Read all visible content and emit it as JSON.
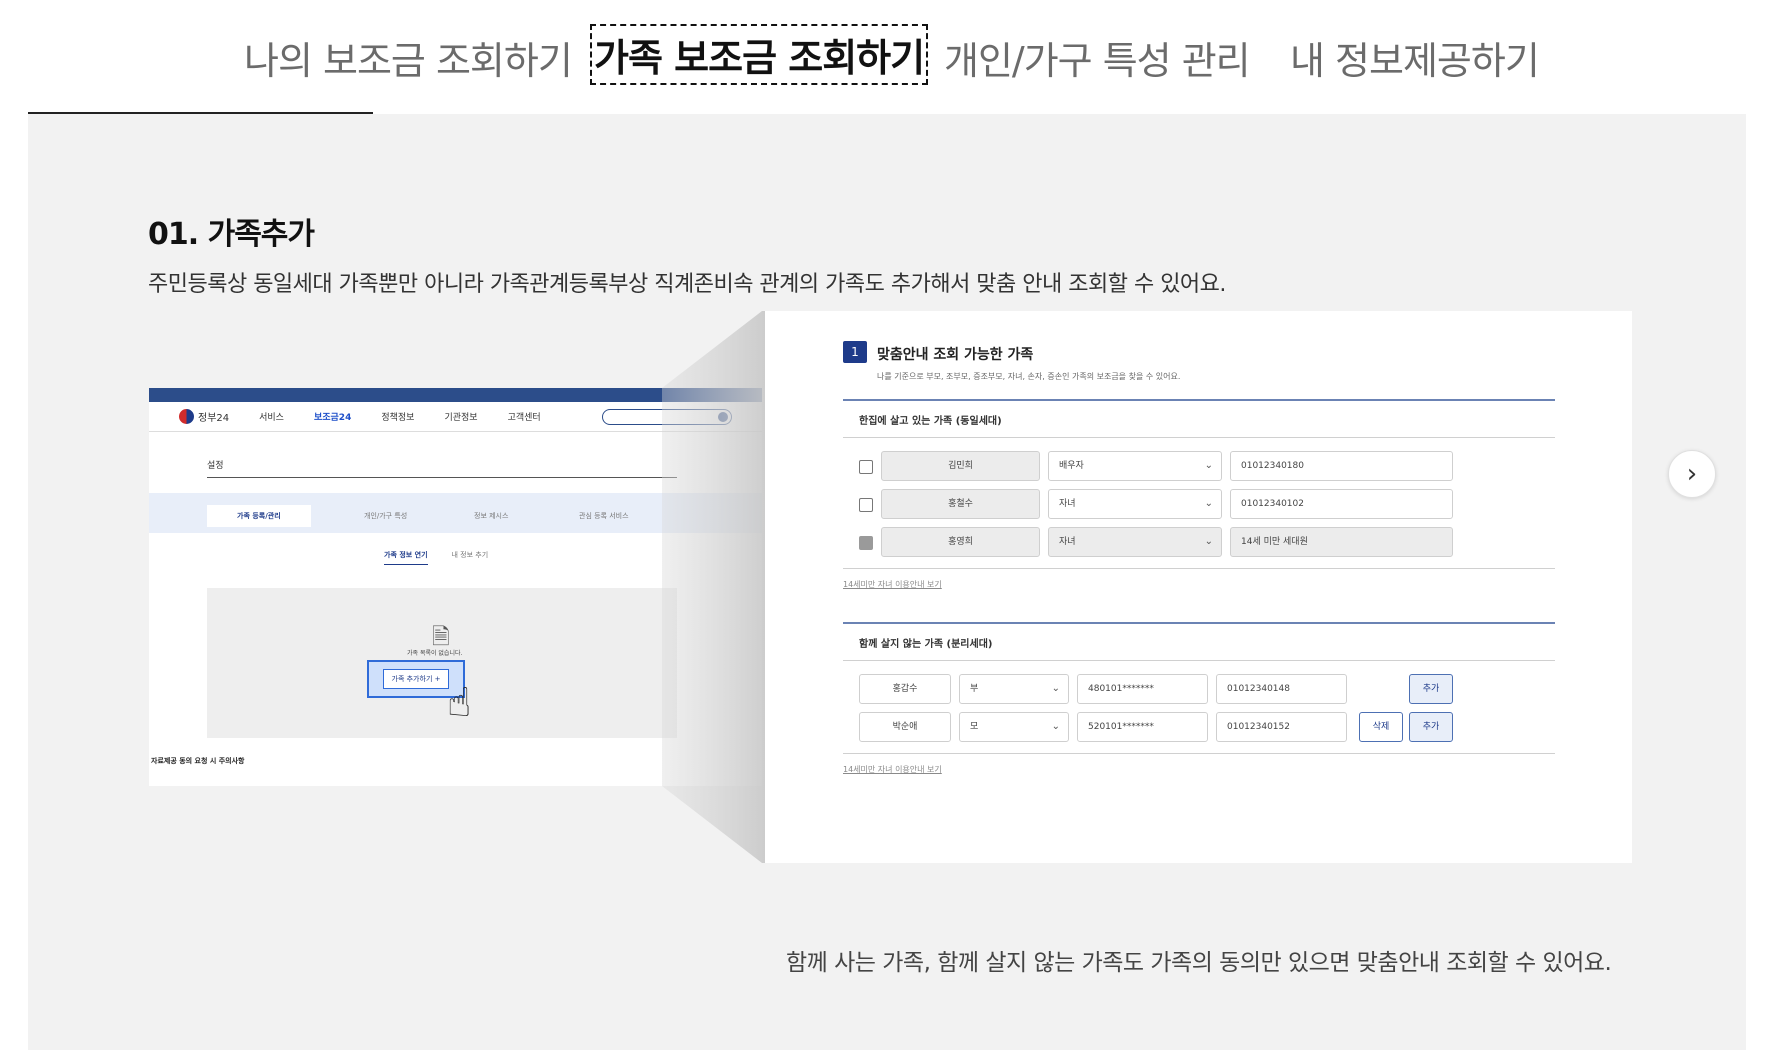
{
  "tabs": [
    {
      "label": "나의 보조금 조회하기",
      "active": false
    },
    {
      "label": "가족 보조금 조회하기",
      "active": true
    },
    {
      "label": "개인/가구 특성 관리",
      "active": false
    },
    {
      "label": "내 정보제공하기",
      "active": false
    }
  ],
  "section": {
    "title": "01. 가족추가",
    "description": "주민등록상 동일세대 가족뿐만 아니라 가족관계등록부상 직계존비속 관계의 가족도 추가해서 맞춤 안내 조회할 수 있어요.",
    "caption": "함께 사는 가족, 함께 살지 않는 가족도 가족의 동의만 있으면 맞춤안내 조회할 수 있어요."
  },
  "mini_screen": {
    "logo": "정부24",
    "nav": [
      "서비스",
      "보조금24",
      "정책정보",
      "기관정보",
      "고객센터"
    ],
    "active_nav": "보조금24",
    "page_title": "설정",
    "subnav": [
      "가족 등록/관리",
      "개인/가구 특성",
      "정보 제시스",
      "관심 등록 서비스"
    ],
    "inner_tabs": [
      "가족 정보 연기",
      "내 정보 추기"
    ],
    "empty_text": "가족 목록이 없습니다.",
    "add_button": "가족 추가하기 +",
    "notice_title": "자료제공 동의 요청 시 주의사항"
  },
  "detail": {
    "step": "1",
    "title": "맞춤안내 조회 가능한 가족",
    "subtitle": "나를 기준으로 부모, 조부모, 증조부모, 자녀, 손자, 증손인 가족의 보조금을 찾을 수 있어요.",
    "cohabit": {
      "heading": "한집에 살고 있는 가족 (동일세대)",
      "rows": [
        {
          "checked": false,
          "name": "김민희",
          "relation": "배우자",
          "phone": "01012340180"
        },
        {
          "checked": false,
          "name": "홍철수",
          "relation": "자녀",
          "phone": "01012340102"
        },
        {
          "checked": true,
          "name": "홍영희",
          "relation": "자녀",
          "phone": "14세 미만 세대원"
        }
      ],
      "help": "14세미만 자녀 이용안내 보기"
    },
    "separate": {
      "heading": "함께 살지 않는 가족 (분리세대)",
      "rows": [
        {
          "name": "홍갑수",
          "relation": "부",
          "birth": "480101*******",
          "phone": "01012340148",
          "add": "추가"
        },
        {
          "name": "박순애",
          "relation": "모",
          "birth": "520101*******",
          "phone": "01012340152",
          "delete": "삭제",
          "add": "추가"
        }
      ],
      "help": "14세미만 자녀 이용안내 보기"
    }
  },
  "icons": {
    "next": "chevron-right-icon",
    "chevron": "chevron-down-icon"
  }
}
